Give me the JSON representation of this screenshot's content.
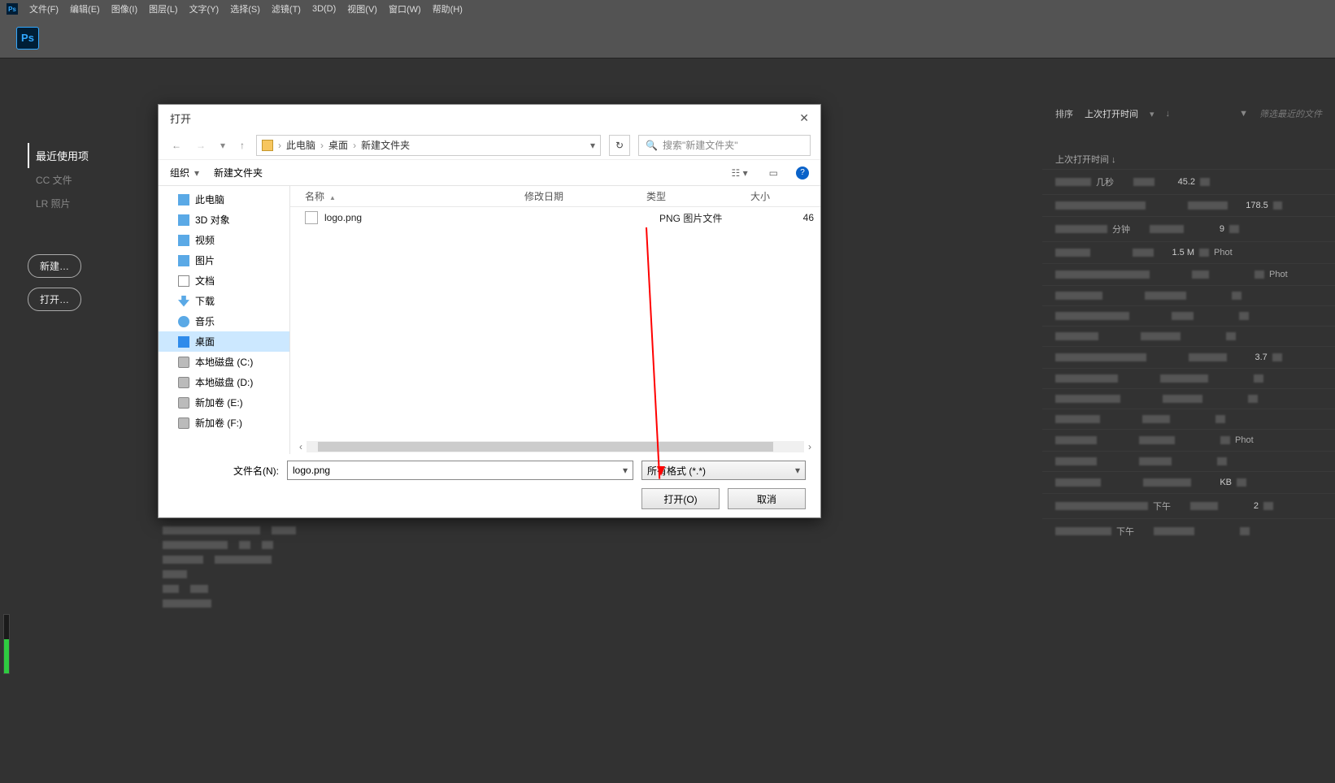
{
  "menubar": {
    "items": [
      "文件(F)",
      "编辑(E)",
      "图像(I)",
      "图层(L)",
      "文字(Y)",
      "选择(S)",
      "滤镜(T)",
      "3D(D)",
      "视图(V)",
      "窗口(W)",
      "帮助(H)"
    ]
  },
  "ps_label": "Ps",
  "leftnav": {
    "recent": "最近使用项",
    "cc": "CC 文件",
    "lr": "LR 照片",
    "new_btn": "新建…",
    "open_btn": "打开…"
  },
  "rightpanel": {
    "sort_label": "排序",
    "sort_value": "上次打开时间",
    "filter_placeholder": "筛选最近的文件",
    "col_time": "上次打开时间 ↓",
    "rows": [
      {
        "time": "几秒",
        "val": "45.2",
        "kind": ""
      },
      {
        "time": "",
        "val": "178.5",
        "kind": ""
      },
      {
        "time": "分钟",
        "val": "9",
        "kind": ""
      },
      {
        "time": "",
        "val": "1.5 M",
        "kind": "Phot"
      },
      {
        "time": "",
        "val": "",
        "kind": "Phot"
      },
      {
        "time": "",
        "val": "",
        "kind": ""
      },
      {
        "time": "",
        "val": "",
        "kind": ""
      },
      {
        "time": "",
        "val": "",
        "kind": ""
      },
      {
        "time": "",
        "val": "3.7",
        "kind": ""
      },
      {
        "time": "",
        "val": "",
        "kind": ""
      },
      {
        "time": "",
        "val": "",
        "kind": ""
      },
      {
        "time": "",
        "val": "",
        "kind": ""
      },
      {
        "time": "",
        "val": "",
        "kind": "Phot"
      },
      {
        "time": "",
        "val": "",
        "kind": ""
      },
      {
        "time": "",
        "val": "KB",
        "kind": ""
      },
      {
        "time": "下午",
        "val": "2",
        "kind": ""
      },
      {
        "time": "下午",
        "val": "",
        "kind": ""
      }
    ]
  },
  "dialog": {
    "title": "打开",
    "breadcrumb": [
      "此电脑",
      "桌面",
      "新建文件夹"
    ],
    "search_placeholder": "搜索\"新建文件夹\"",
    "organize": "组织",
    "newfolder": "新建文件夹",
    "tree": [
      {
        "icon": "ico-pc",
        "label": "此电脑"
      },
      {
        "icon": "ico-3d",
        "label": "3D 对象"
      },
      {
        "icon": "ico-video",
        "label": "视频"
      },
      {
        "icon": "ico-pic",
        "label": "图片"
      },
      {
        "icon": "ico-doc",
        "label": "文档"
      },
      {
        "icon": "ico-dl",
        "label": "下载"
      },
      {
        "icon": "ico-music",
        "label": "音乐"
      },
      {
        "icon": "ico-desk",
        "label": "桌面",
        "selected": true
      },
      {
        "icon": "ico-disk",
        "label": "本地磁盘 (C:)"
      },
      {
        "icon": "ico-disk",
        "label": "本地磁盘 (D:)"
      },
      {
        "icon": "ico-disk",
        "label": "新加卷 (E:)"
      },
      {
        "icon": "ico-disk",
        "label": "新加卷 (F:)"
      }
    ],
    "cols": {
      "name": "名称",
      "date": "修改日期",
      "type": "类型",
      "size": "大小"
    },
    "files": [
      {
        "name": "logo.png",
        "date": "",
        "type": "PNG 图片文件",
        "size": "46"
      }
    ],
    "filename_label": "文件名(N):",
    "filename_value": "logo.png",
    "filetype_value": "所有格式 (*.*)",
    "open_btn": "打开(O)",
    "cancel_btn": "取消"
  }
}
